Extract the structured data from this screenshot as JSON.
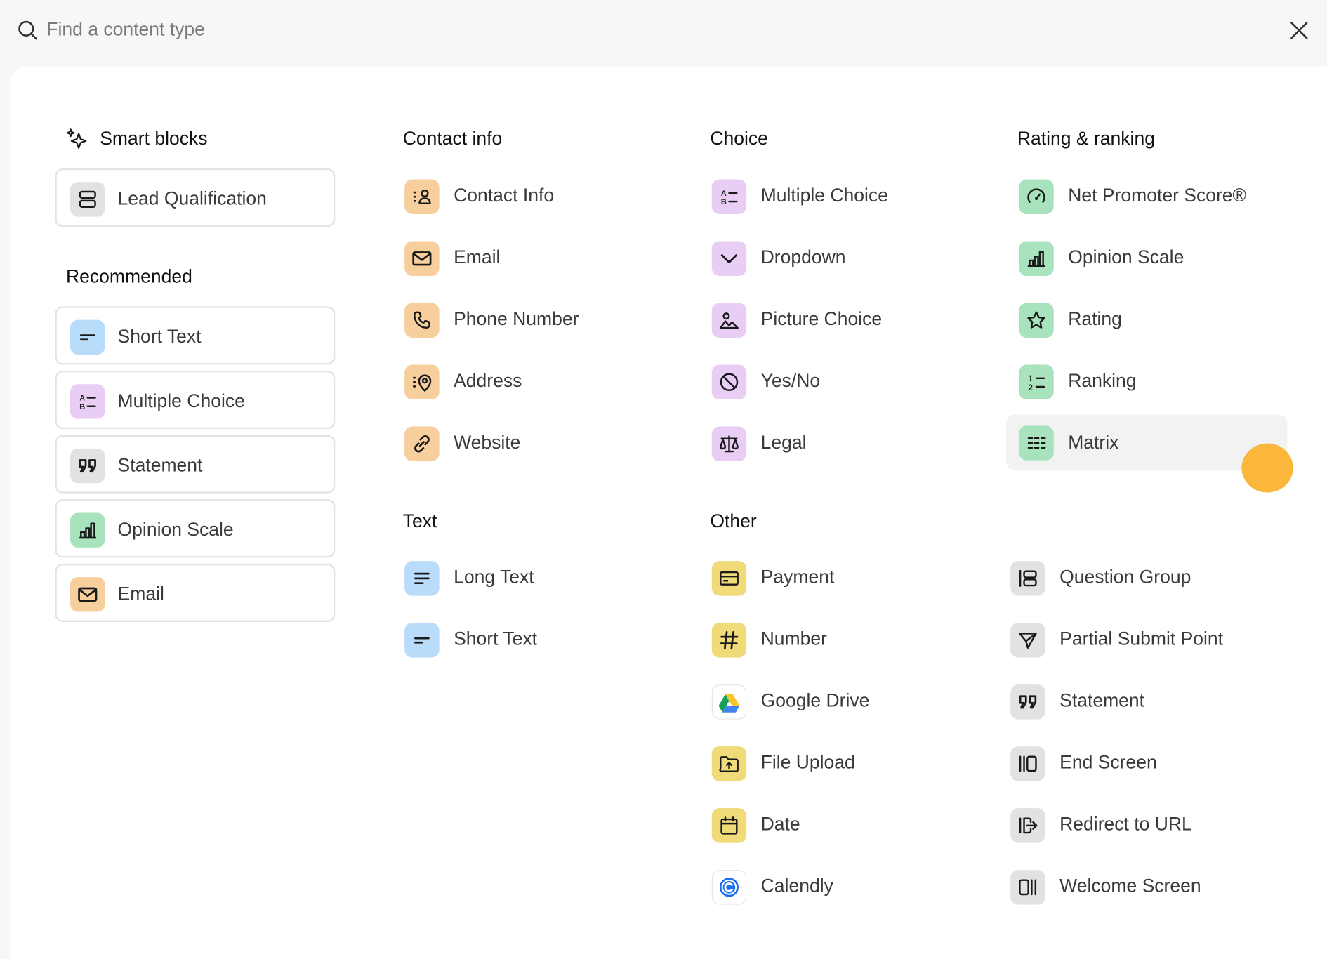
{
  "search": {
    "placeholder": "Find a content type",
    "value": ""
  },
  "colors": {
    "smart": "#e2e2e2",
    "text": "#b9dcfa",
    "choice": "#e8cdf4",
    "rating": "#a8e3bd",
    "contact": "#f6cf9d",
    "other": "#f1da78",
    "cursor": "#fbb63c"
  },
  "smart_blocks": {
    "title": "Smart blocks",
    "items": [
      {
        "label": "Lead Qualification",
        "icon": "lead-qualification-icon"
      }
    ]
  },
  "recommended": {
    "title": "Recommended",
    "items": [
      {
        "label": "Short Text",
        "icon": "short-text-icon"
      },
      {
        "label": "Multiple Choice",
        "icon": "multiple-choice-icon"
      },
      {
        "label": "Statement",
        "icon": "quote-icon"
      },
      {
        "label": "Opinion Scale",
        "icon": "bar-chart-icon"
      },
      {
        "label": "Email",
        "icon": "envelope-icon"
      }
    ]
  },
  "contact_info": {
    "title": "Contact info",
    "items": [
      {
        "label": "Contact Info",
        "icon": "contact-card-icon"
      },
      {
        "label": "Email",
        "icon": "envelope-icon"
      },
      {
        "label": "Phone Number",
        "icon": "phone-icon"
      },
      {
        "label": "Address",
        "icon": "map-pin-icon"
      },
      {
        "label": "Website",
        "icon": "link-icon"
      }
    ]
  },
  "choice": {
    "title": "Choice",
    "items": [
      {
        "label": "Multiple Choice",
        "icon": "multiple-choice-icon"
      },
      {
        "label": "Dropdown",
        "icon": "chevron-down-icon"
      },
      {
        "label": "Picture Choice",
        "icon": "picture-icon"
      },
      {
        "label": "Yes/No",
        "icon": "yes-no-icon"
      },
      {
        "label": "Legal",
        "icon": "scales-icon"
      }
    ]
  },
  "rating": {
    "title": "Rating & ranking",
    "items": [
      {
        "label": "Net Promoter Score®",
        "icon": "gauge-icon"
      },
      {
        "label": "Opinion Scale",
        "icon": "bar-chart-icon"
      },
      {
        "label": "Rating",
        "icon": "star-icon"
      },
      {
        "label": "Ranking",
        "icon": "ranking-icon"
      },
      {
        "label": "Matrix",
        "icon": "grid-icon"
      }
    ]
  },
  "text": {
    "title": "Text",
    "items": [
      {
        "label": "Long Text",
        "icon": "long-text-icon"
      },
      {
        "label": "Short Text",
        "icon": "short-text-icon"
      }
    ]
  },
  "other": {
    "title": "Other",
    "items": [
      {
        "label": "Payment",
        "icon": "credit-card-icon"
      },
      {
        "label": "Number",
        "icon": "hash-icon"
      },
      {
        "label": "Google Drive",
        "icon": "google-drive-icon"
      },
      {
        "label": "File Upload",
        "icon": "folder-upload-icon"
      },
      {
        "label": "Date",
        "icon": "calendar-icon"
      },
      {
        "label": "Calendly",
        "icon": "calendly-icon"
      }
    ],
    "items2": [
      {
        "label": "Question Group",
        "icon": "question-group-icon"
      },
      {
        "label": "Partial Submit Point",
        "icon": "send-icon"
      },
      {
        "label": "Statement",
        "icon": "quote-icon"
      },
      {
        "label": "End Screen",
        "icon": "end-screen-icon"
      },
      {
        "label": "Redirect to URL",
        "icon": "redirect-icon"
      },
      {
        "label": "Welcome Screen",
        "icon": "welcome-screen-icon"
      }
    ]
  }
}
